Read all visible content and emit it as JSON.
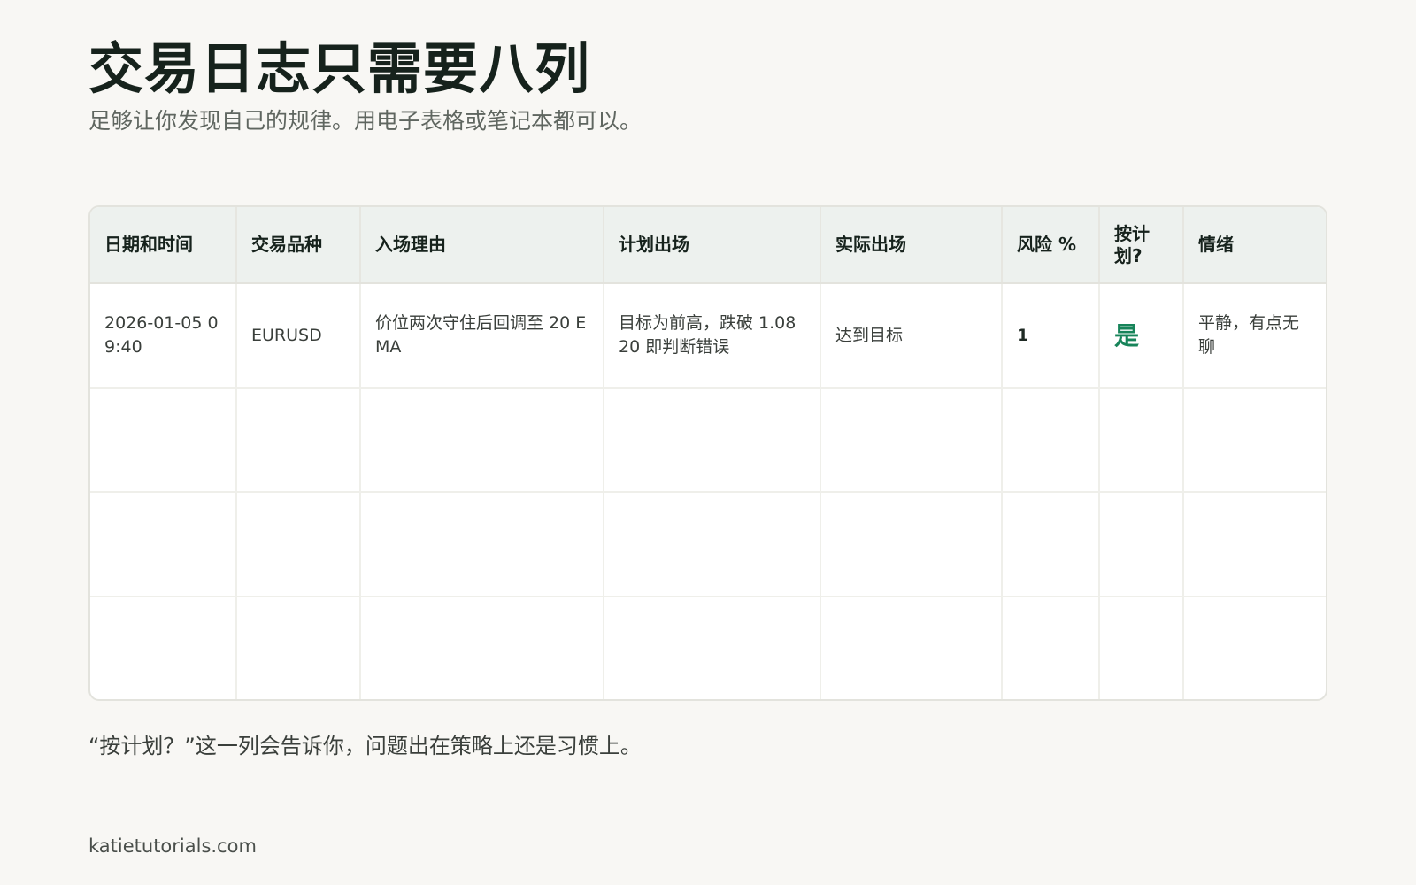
{
  "page": {
    "title": "交易日志只需要八列",
    "subtitle": "足够让你发现自己的规律。用电子表格或笔记本都可以。",
    "note": "“按计划？”这一列会告诉你，问题出在策略上还是习惯上。",
    "footer": "katietutorials.com"
  },
  "table": {
    "headers": [
      "日期和时间",
      "交易品种",
      "入场理由",
      "计划出场",
      "实际出场",
      "风险 %",
      "按计划?",
      "情绪"
    ],
    "rows": [
      [
        "2026-01-05 09:40",
        "EURUSD",
        "价位两次守住后回调至 20 EMA",
        "目标为前高，跌破 1.0820 即判断错误",
        "达到目标",
        "1",
        "是",
        "平静，有点无聊"
      ],
      [
        "",
        "",
        "",
        "",
        "",
        "",
        "",
        ""
      ],
      [
        "",
        "",
        "",
        "",
        "",
        "",
        "",
        ""
      ],
      [
        "",
        "",
        "",
        "",
        "",
        "",
        "",
        ""
      ]
    ]
  },
  "colors": {
    "background": "#f8f7f4",
    "header_bg": "#edf1ee",
    "accent_green": "#17845a",
    "border": "#e3e3dd"
  }
}
